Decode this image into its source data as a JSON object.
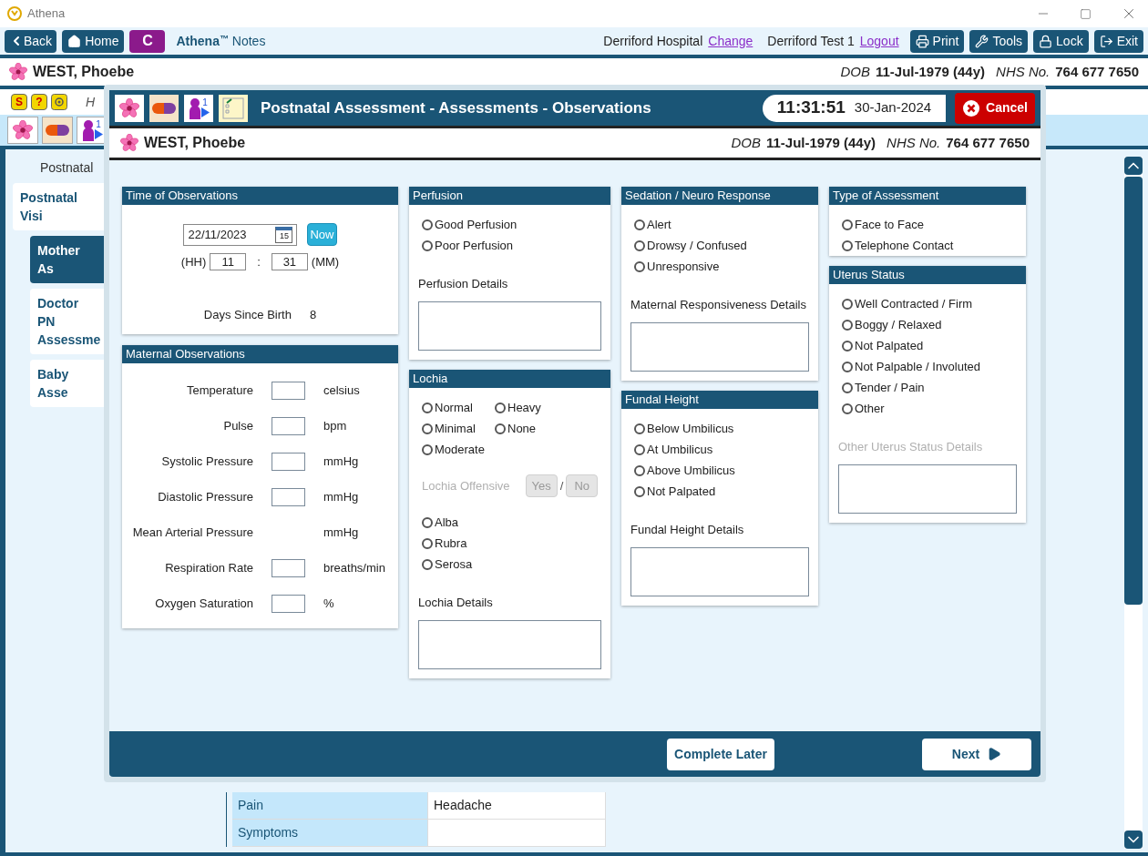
{
  "window": {
    "title": "Athena"
  },
  "toolbar": {
    "back": "Back",
    "home": "Home",
    "c_button": "C",
    "brand": "Athena",
    "brand_mark": "™",
    "brand_suffix": "Notes",
    "hospital": "Derriford Hospital",
    "change_link": "Change",
    "user": "Derriford Test 1",
    "logout_link": "Logout",
    "buttons": [
      {
        "label": "Print",
        "kind": "print"
      },
      {
        "label": "Tools",
        "kind": "tools"
      },
      {
        "label": "Lock",
        "kind": "lock"
      },
      {
        "label": "Exit",
        "kind": "exit"
      }
    ]
  },
  "patient": {
    "name": "WEST, Phoebe",
    "dob_label": "DOB",
    "dob": "11-Jul-1979 (44y)",
    "nhs_label": "NHS No.",
    "nhs": "764 677 7650"
  },
  "quick_icons": [
    {
      "kind": "s",
      "text": "S"
    },
    {
      "kind": "help",
      "text": "?"
    },
    {
      "kind": "gear"
    }
  ],
  "cut_text": "H",
  "background_badge": "1",
  "section_title": "Postnatal",
  "nav": [
    {
      "label": "Postnatal Visi",
      "selected": false,
      "children": [
        {
          "label": "Mother As",
          "selected": true
        },
        {
          "label": "Doctor PN Assessme",
          "selected": false
        },
        {
          "label": "Baby Asse",
          "selected": false
        }
      ]
    }
  ],
  "table_rows": [
    {
      "label": "Pain",
      "value": "Headache"
    },
    {
      "label": "Symptoms"
    }
  ],
  "modal": {
    "badge": "1",
    "title": "Postnatal Assessment - Assessments - Observations",
    "time": "11:31:51",
    "date": "30-Jan-2024",
    "cancel": "Cancel",
    "patient": {
      "name": "WEST, Phoebe",
      "dob_label": "DOB",
      "dob": "11-Jul-1979 (44y)",
      "nhs_label": "NHS No.",
      "nhs": "764 677 7650"
    },
    "time_panel": {
      "title": "Time of Observations",
      "date_value": "22/11/2023",
      "calendar_day": "15",
      "now": "Now",
      "hh_label": "(HH)",
      "hh": "11",
      "separator": ":",
      "mm": "31",
      "mm_label": "(MM)",
      "days_label": "Days Since Birth",
      "days": "8"
    },
    "maternal": {
      "title": "Maternal Observations",
      "rows": [
        {
          "label": "Temperature",
          "unit": "celsius",
          "kind": "input"
        },
        {
          "label": "Pulse",
          "unit": "bpm",
          "kind": "input"
        },
        {
          "label": "Systolic Pressure",
          "unit": "mmHg",
          "kind": "input"
        },
        {
          "label": "Diastolic Pressure",
          "unit": "mmHg",
          "kind": "input"
        },
        {
          "label": "Mean Arterial Pressure",
          "unit": "mmHg",
          "kind": "calculated"
        },
        {
          "label": "Respiration Rate",
          "unit": "breaths/min",
          "kind": "input"
        },
        {
          "label": "Oxygen Saturation",
          "unit": "%",
          "kind": "input"
        }
      ]
    },
    "columns": [
      [
        {
          "title": "Perfusion",
          "items": [
            {
              "kind": "radios",
              "options": [
                {
                  "label": "Good Perfusion",
                  "selected": false
                },
                {
                  "label": "Poor Perfusion",
                  "selected": false
                }
              ]
            },
            {
              "kind": "label",
              "text": "Perfusion Details",
              "disabled": false
            },
            {
              "kind": "textarea"
            }
          ]
        },
        {
          "title": "Lochia",
          "items": [
            {
              "kind": "radio-grid",
              "options": [
                {
                  "label": "Normal",
                  "selected": false
                },
                {
                  "label": "Heavy",
                  "selected": false
                },
                {
                  "label": "Minimal",
                  "selected": false
                },
                {
                  "label": "None",
                  "selected": false
                },
                {
                  "label": "Moderate",
                  "selected": false
                }
              ]
            },
            {
              "kind": "yesno",
              "text": "Lochia Offensive",
              "yes": "Yes",
              "separator": "/",
              "no": "No",
              "disabled": true
            },
            {
              "kind": "radios",
              "options": [
                {
                  "label": "Alba",
                  "selected": false
                },
                {
                  "label": "Rubra",
                  "selected": false
                },
                {
                  "label": "Serosa",
                  "selected": false
                }
              ]
            },
            {
              "kind": "label",
              "text": "Lochia Details",
              "disabled": false
            },
            {
              "kind": "textarea"
            }
          ]
        }
      ],
      [
        {
          "title": "Sedation / Neuro Response",
          "items": [
            {
              "kind": "radios",
              "options": [
                {
                  "label": "Alert",
                  "selected": false
                },
                {
                  "label": "Drowsy / Confused",
                  "selected": false
                },
                {
                  "label": "Unresponsive",
                  "selected": false
                }
              ]
            },
            {
              "kind": "label",
              "text": "Maternal Responsiveness Details",
              "disabled": false
            },
            {
              "kind": "textarea"
            }
          ]
        },
        {
          "title": "Fundal Height",
          "items": [
            {
              "kind": "radios",
              "options": [
                {
                  "label": "Below Umbilicus",
                  "selected": false
                },
                {
                  "label": "At Umbilicus",
                  "selected": false
                },
                {
                  "label": "Above Umbilicus",
                  "selected": false
                },
                {
                  "label": "Not Palpated",
                  "selected": false
                }
              ]
            },
            {
              "kind": "label",
              "text": "Fundal Height Details",
              "disabled": false
            },
            {
              "kind": "textarea"
            }
          ]
        }
      ],
      [
        {
          "title": "Type of Assessment",
          "items": [
            {
              "kind": "radios",
              "options": [
                {
                  "label": "Face to Face",
                  "selected": false
                },
                {
                  "label": "Telephone Contact",
                  "selected": false
                }
              ]
            }
          ]
        },
        {
          "title": "Uterus Status",
          "items": [
            {
              "kind": "radios",
              "options": [
                {
                  "label": "Well Contracted / Firm",
                  "selected": false
                },
                {
                  "label": "Boggy / Relaxed",
                  "selected": false
                },
                {
                  "label": "Not Palpated",
                  "selected": false
                },
                {
                  "label": "Not Palpable / Involuted",
                  "selected": false
                },
                {
                  "label": "Tender / Pain",
                  "selected": false
                },
                {
                  "label": "Other",
                  "selected": false
                }
              ]
            },
            {
              "kind": "label",
              "text": "Other Uterus Status Details",
              "disabled": true
            },
            {
              "kind": "textarea"
            }
          ]
        }
      ]
    ],
    "complete_later": "Complete Later",
    "next": "Next"
  }
}
